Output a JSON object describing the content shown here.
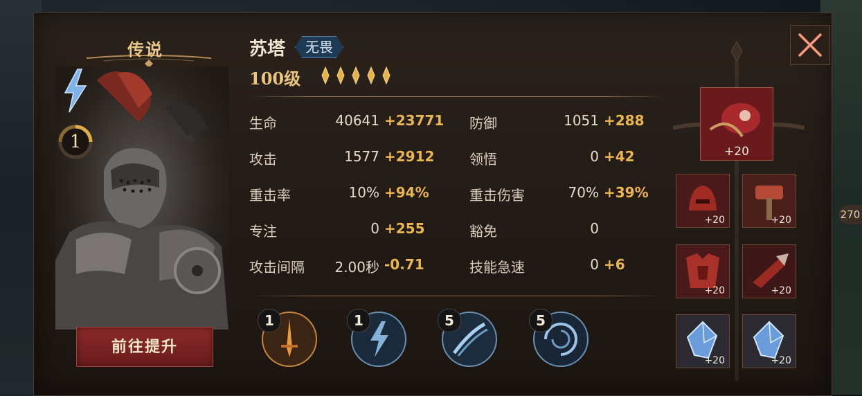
{
  "hero": {
    "rarity": "传说",
    "name": "苏塔",
    "faction": "无畏",
    "level": "100级",
    "stars": 5,
    "awaken_level": "1",
    "upgrade_button": "前往提升"
  },
  "stats": [
    {
      "label": "生命",
      "base": "40641",
      "bonus": "+23771"
    },
    {
      "label": "防御",
      "base": "1051",
      "bonus": "+288"
    },
    {
      "label": "攻击",
      "base": "1577",
      "bonus": "+2912"
    },
    {
      "label": "领悟",
      "base": "0",
      "bonus": "+42"
    },
    {
      "label": "重击率",
      "base": "10%",
      "bonus": "+94%"
    },
    {
      "label": "重击伤害",
      "base": "70%",
      "bonus": "+39%"
    },
    {
      "label": "专注",
      "base": "0",
      "bonus": "+255"
    },
    {
      "label": "豁免",
      "base": "0",
      "bonus": ""
    },
    {
      "label": "攻击间隔",
      "base": "2.00秒",
      "bonus": "-0.71"
    },
    {
      "label": "技能急速",
      "base": "0",
      "bonus": "+6"
    }
  ],
  "skills": [
    {
      "level": "1",
      "icon": "sword-skill-icon"
    },
    {
      "level": "1",
      "icon": "lightning-skill-icon"
    },
    {
      "level": "5",
      "icon": "slash-skill-icon"
    },
    {
      "level": "5",
      "icon": "vortex-skill-icon"
    }
  ],
  "equipment": [
    {
      "slot": "weapon-main",
      "enhance": "+20",
      "icon": "crimson-claw-icon"
    },
    {
      "slot": "helmet",
      "enhance": "+20",
      "icon": "helmet-icon"
    },
    {
      "slot": "hammer",
      "enhance": "+20",
      "icon": "hammer-icon"
    },
    {
      "slot": "armor",
      "enhance": "+20",
      "icon": "armor-icon"
    },
    {
      "slot": "gauntlet",
      "enhance": "+20",
      "icon": "gauntlet-icon"
    },
    {
      "slot": "crystal-1",
      "enhance": "+20",
      "icon": "crystal-icon"
    },
    {
      "slot": "crystal-2",
      "enhance": "+20",
      "icon": "crystal-icon"
    }
  ],
  "side_counter": "270",
  "colors": {
    "bonus": "#eab64f",
    "rarity": "#e8c68a",
    "faction_bg": "#1e3a55",
    "upgrade_btn": "#8c2a2a"
  }
}
